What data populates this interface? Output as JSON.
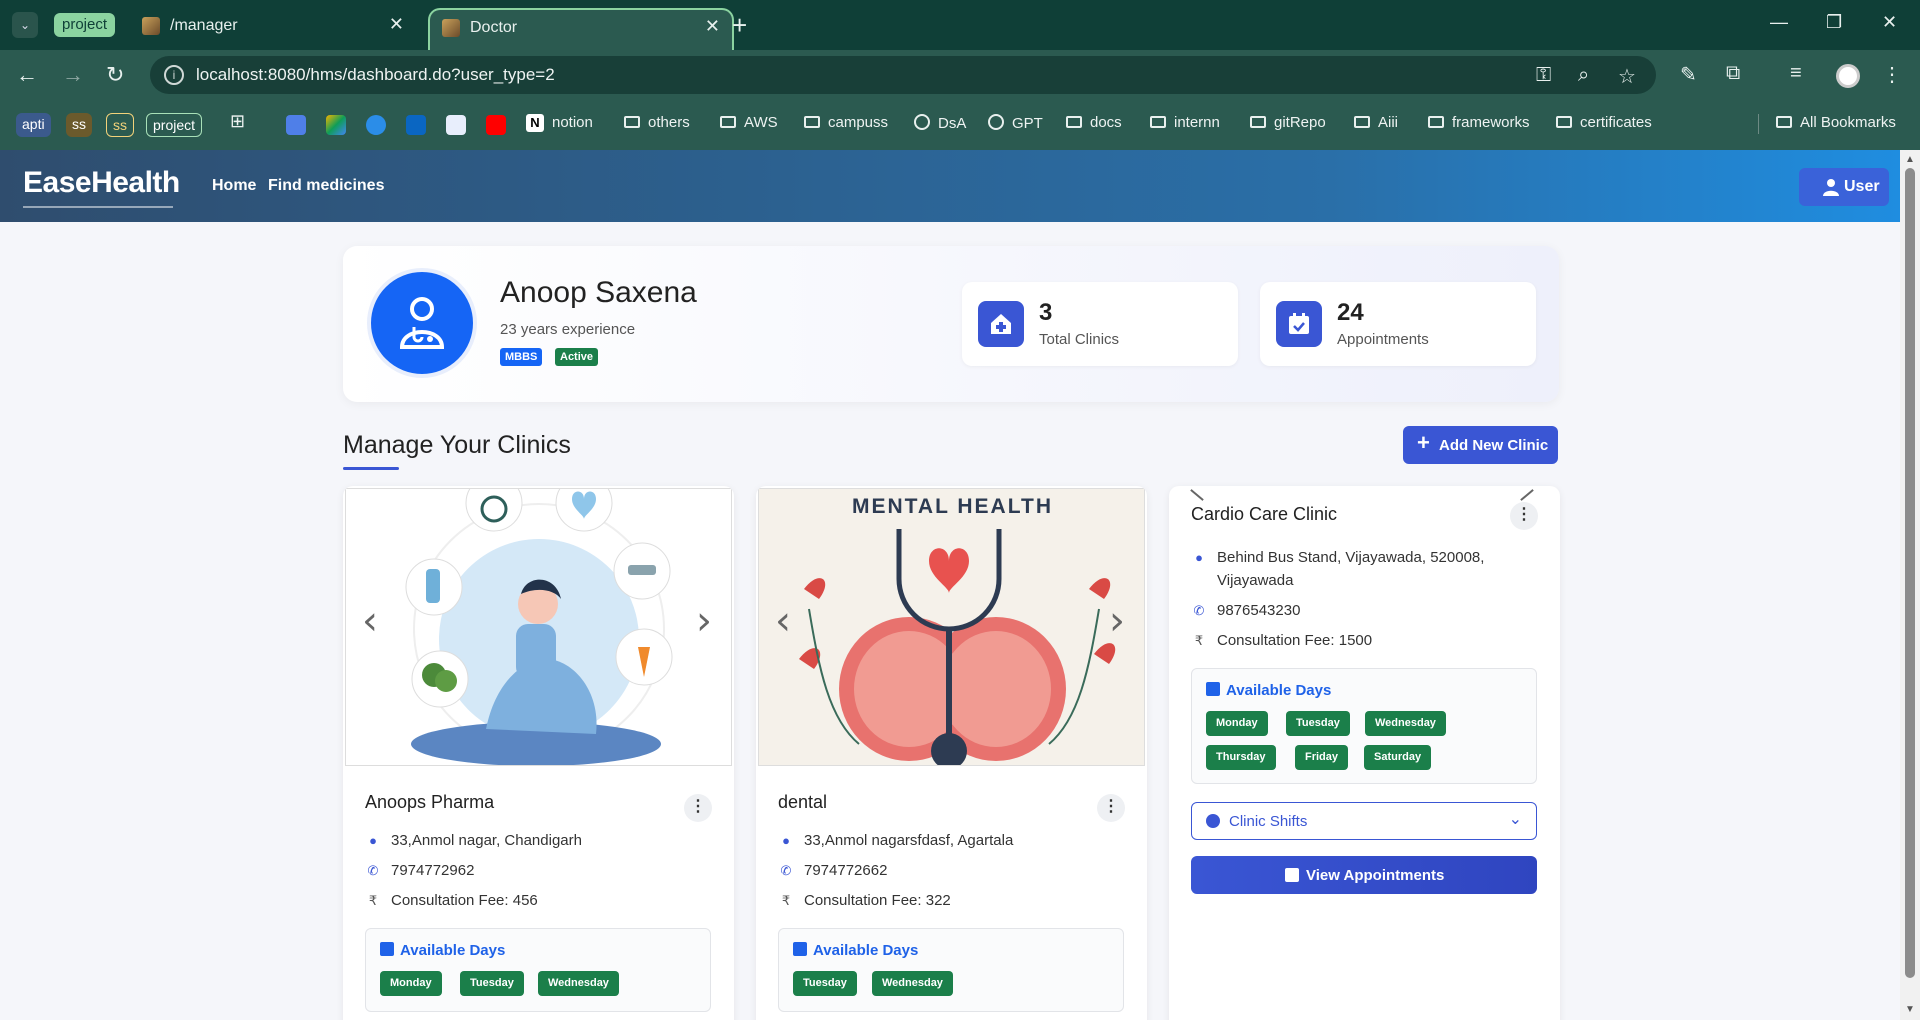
{
  "browser": {
    "tab_group_label": "project",
    "tabs": [
      {
        "title": "/manager"
      },
      {
        "title": "Doctor"
      }
    ],
    "url": "localhost:8080/hms/dashboard.do?user_type=2",
    "bookmarks": {
      "chips": [
        "apti",
        "ss",
        "ss",
        "project"
      ],
      "items": [
        "notion",
        "others",
        "AWS",
        "campuss",
        "DsA",
        "GPT",
        "docs",
        "internn",
        "gitRepo",
        "Aiii",
        "frameworks",
        "certificates"
      ],
      "all_label": "All Bookmarks"
    }
  },
  "app": {
    "logo": "EaseHealth",
    "nav": [
      "Home",
      "Find medicines"
    ],
    "user_label": "User"
  },
  "doctor": {
    "name": "Anoop Saxena",
    "experience": "23 years experience",
    "badges": [
      "MBBS",
      "Active"
    ],
    "stats": {
      "clinics_value": "3",
      "clinics_label": "Total Clinics",
      "appointments_value": "24",
      "appointments_label": "Appointments"
    }
  },
  "section": {
    "title": "Manage Your Clinics",
    "add_button": "Add New Clinic"
  },
  "clinics": [
    {
      "name": "Anoops Pharma",
      "address": "33,Anmol nagar, Chandigarh",
      "phone": "7974772962",
      "fee": "Consultation Fee: 456",
      "days_title": "Available Days",
      "days": [
        "Monday",
        "Tuesday",
        "Wednesday"
      ]
    },
    {
      "name": "dental",
      "image_title": "MENTAL HEALTH",
      "address": "33,Anmol nagarsfdasf, Agartala",
      "phone": "7974772662",
      "fee": "Consultation Fee: 322",
      "days_title": "Available Days",
      "days": [
        "Tuesday",
        "Wednesday"
      ]
    },
    {
      "name": "Cardio Care Clinic",
      "address_line1": "Behind Bus Stand, Vijayawada, 520008,",
      "address_line2": "Vijayawada",
      "phone": "9876543230",
      "fee": "Consultation Fee: 1500",
      "days_title": "Available Days",
      "days": [
        "Monday",
        "Tuesday",
        "Wednesday",
        "Thursday",
        "Friday",
        "Saturday"
      ],
      "shifts_label": "Clinic Shifts",
      "view_button": "View Appointments"
    }
  ],
  "colors": {
    "primary": "#3a56d4",
    "day_pill": "#1b7f4a",
    "avatar": "#1565f5"
  }
}
